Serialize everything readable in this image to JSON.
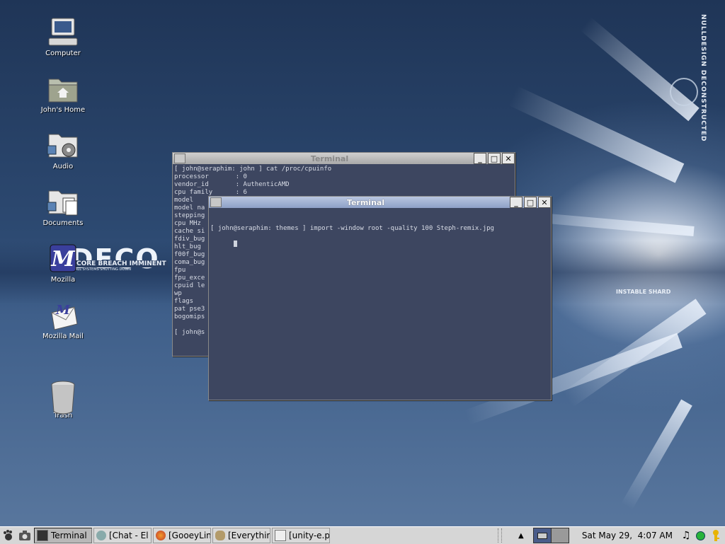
{
  "desktop": {
    "icons": [
      {
        "label": "Computer"
      },
      {
        "label": "John's Home"
      },
      {
        "label": "Audio"
      },
      {
        "label": "Documents"
      },
      {
        "label": "Mozilla"
      },
      {
        "label": "Mozilla Mail"
      },
      {
        "label": "Trash"
      }
    ],
    "wallpaper": {
      "brand_vertical": "NULLDESIGN DECONSTRUCTED",
      "big_text": "DECO",
      "subtitle": "CORE BREACH IMMINENT",
      "small_text": "ALL SYSTEMS SHUTTING DOWN",
      "right_text": "INSTABLE SHARD"
    }
  },
  "windows": {
    "back_terminal": {
      "title": "Terminal",
      "lines": [
        "[ john@seraphim: john ] cat /proc/cpuinfo",
        "processor       : 0",
        "vendor_id       : AuthenticAMD",
        "cpu family      : 6",
        "model",
        "model na",
        "stepping",
        "cpu MHz",
        "cache si",
        "fdiv_bug",
        "hlt_bug",
        "f00f_bug",
        "coma_bug",
        "fpu",
        "fpu_exce",
        "cpuid le",
        "wp",
        "flags",
        "pat pse3",
        "bogomips",
        "",
        "[ john@s"
      ]
    },
    "front_terminal": {
      "title": "Terminal",
      "prompt": "[ john@seraphim: themes ] import -window root -quality 100 Steph-remix.jpg"
    }
  },
  "panel": {
    "tasks": [
      {
        "label": "Terminal",
        "icon": "terminal-icon",
        "active": true
      },
      {
        "label": "[Chat - El",
        "icon": "chat-icon",
        "active": false
      },
      {
        "label": "[GooeyLin",
        "icon": "firefox-icon",
        "active": false
      },
      {
        "label": "[Everythir",
        "icon": "gimp-icon",
        "active": false
      },
      {
        "label": "[unity-e.p",
        "icon": "image-icon",
        "active": false
      }
    ],
    "clock": "Sat May 29,  4:07 AM"
  }
}
